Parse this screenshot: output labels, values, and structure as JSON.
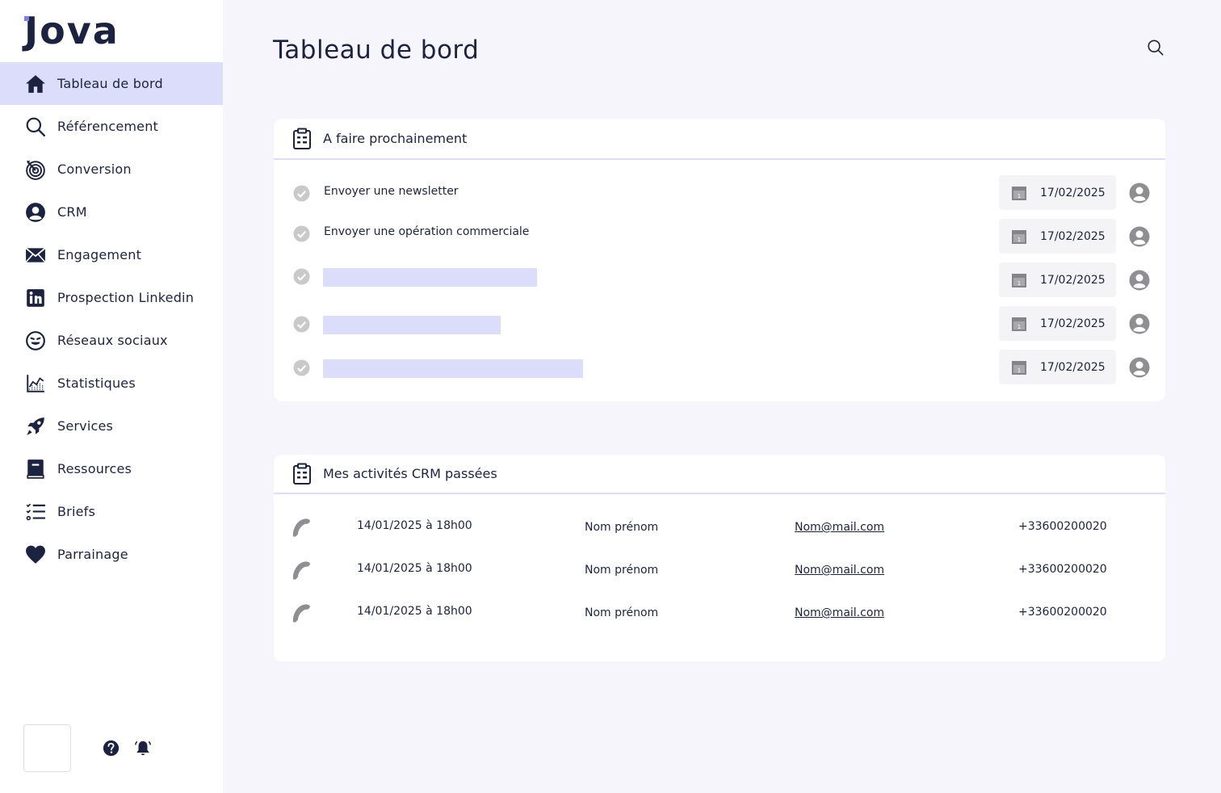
{
  "brand": {
    "logo_text": "Jova",
    "accent": "#7c7ff0",
    "active_bg": "#dcddfa",
    "text_color": "#1c2340"
  },
  "sidebar": {
    "items": [
      {
        "label": "Tableau de bord",
        "icon": "home-icon",
        "active": true
      },
      {
        "label": "Référencement",
        "icon": "search-icon"
      },
      {
        "label": "Conversion",
        "icon": "target-icon"
      },
      {
        "label": "CRM",
        "icon": "user-circle-icon"
      },
      {
        "label": "Engagement",
        "icon": "mail-icon"
      },
      {
        "label": "Prospection Linkedin",
        "icon": "linkedin-icon"
      },
      {
        "label": "Réseaux sociaux",
        "icon": "smiley-icon"
      },
      {
        "label": "Statistiques",
        "icon": "chart-icon"
      },
      {
        "label": "Services",
        "icon": "rocket-icon"
      },
      {
        "label": "Ressources",
        "icon": "book-icon"
      },
      {
        "label": "Briefs",
        "icon": "checklist-icon"
      },
      {
        "label": "Parrainage",
        "icon": "heart-icon"
      }
    ],
    "footer": {
      "help_icon": "help-icon",
      "bell_icon": "bell-icon"
    }
  },
  "header": {
    "title": "Tableau de bord",
    "search_icon": "search-icon"
  },
  "todo": {
    "title": "A faire prochainement",
    "items": [
      {
        "text": "Envoyer une newsletter",
        "date": "17/02/2025"
      },
      {
        "text": "Envoyer une opération commerciale",
        "date": "17/02/2025"
      },
      {
        "text": "",
        "date": "17/02/2025"
      },
      {
        "text": "",
        "date": "17/02/2025"
      },
      {
        "text": "",
        "date": "17/02/2025"
      }
    ]
  },
  "crm": {
    "title": "Mes activités CRM passées",
    "rows": [
      {
        "datetime": "14/01/2025 à 18h00",
        "name": "Nom prénom",
        "email": "Nom@mail.com",
        "phone": "+33600200020"
      },
      {
        "datetime": "14/01/2025 à 18h00",
        "name": "Nom prénom",
        "email": "Nom@mail.com",
        "phone": "+33600200020"
      },
      {
        "datetime": "14/01/2025 à 18h00",
        "name": "Nom prénom",
        "email": "Nom@mail.com",
        "phone": "+33600200020"
      }
    ]
  }
}
